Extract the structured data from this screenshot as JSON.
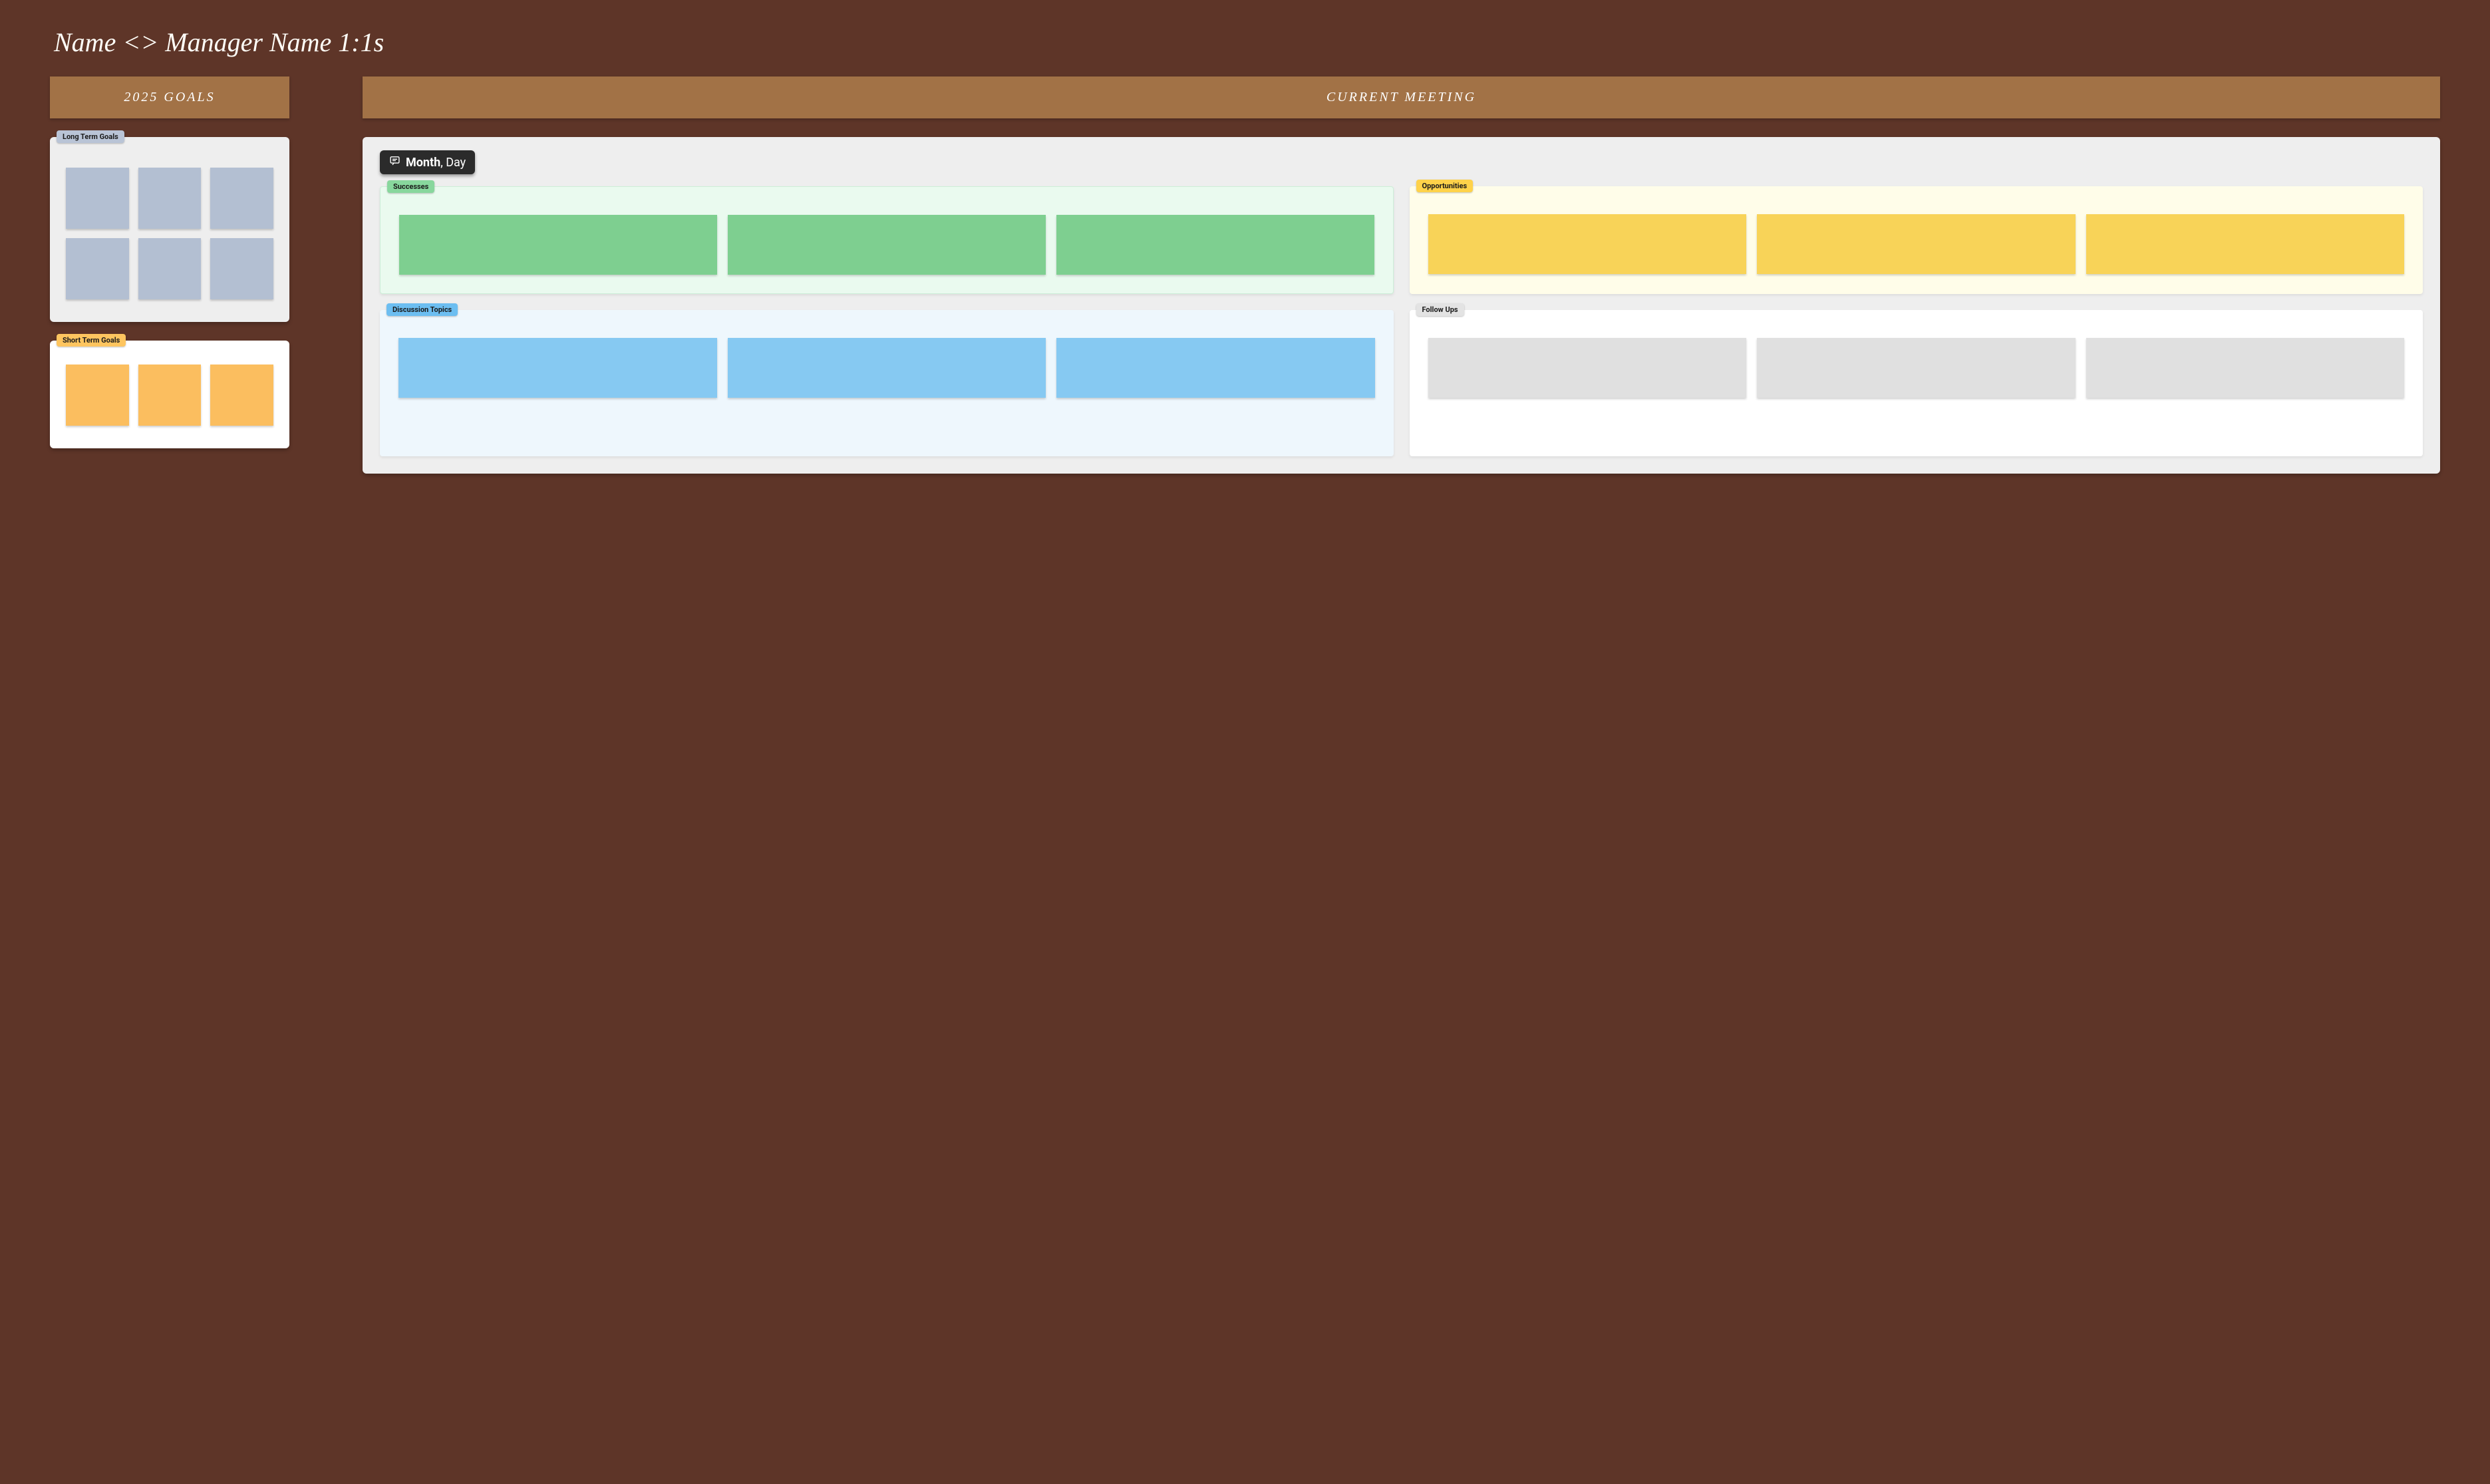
{
  "title": "Name <> Manager Name 1:1s",
  "left": {
    "header": "2025 GOALS",
    "long_term": {
      "tag": "Long Term Goals",
      "cards": 6
    },
    "short_term": {
      "tag": "Short Term Goals",
      "cards": 3
    }
  },
  "right": {
    "header": "CURRENT MEETING",
    "date": {
      "month": "Month",
      "separator": ",",
      "day": "Day"
    },
    "successes": {
      "tag": "Successes",
      "cards": 3
    },
    "opportunities": {
      "tag": "Opportunities",
      "cards": 3
    },
    "discussion": {
      "tag": "Discussion Topics",
      "cards": 3
    },
    "followups": {
      "tag": "Follow Ups",
      "cards": 3
    }
  },
  "colors": {
    "background": "#5e3528",
    "header_bar": "#a27246",
    "long_card": "#b3bfd2",
    "short_card": "#fbbe5f",
    "success_card": "#7ecf90",
    "opp_card": "#f8d358",
    "disc_card": "#86c9f2",
    "follow_card": "#e0e0e0"
  }
}
